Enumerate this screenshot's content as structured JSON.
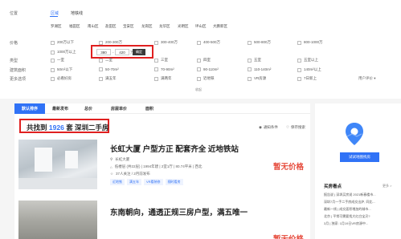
{
  "filters": {
    "position": {
      "label": "位置",
      "tabs": [
        "区域",
        "地铁线"
      ],
      "subitems": [
        "罗湖区",
        "福田区",
        "南山区",
        "盐田区",
        "宝安区",
        "龙岗区",
        "龙华区",
        "光明区",
        "坪山区",
        "大鹏新区"
      ]
    },
    "price": {
      "label": "价格",
      "options": [
        "200万以下",
        "200-300万",
        "300-400万",
        "400-500万",
        "500-800万",
        "800-1000万",
        "1000万以上"
      ],
      "min_value": "380",
      "max_value": "420",
      "unit": "万",
      "dash": "-",
      "confirm_label": "确定"
    },
    "type": {
      "label": "类型",
      "options": [
        "一室",
        "二室",
        "三室",
        "四室",
        "五室",
        "五室以上"
      ]
    },
    "area": {
      "label": "建筑面积",
      "options": [
        "50m²以下",
        "50-70m²",
        "70-90m²",
        "90-110m²",
        "110-140m²",
        "140m²以上"
      ]
    },
    "more": {
      "label": "更多选项",
      "options": [
        "必看好房",
        "满五年",
        "满两年",
        "近地铁",
        "VR房源",
        "7日新上"
      ],
      "more_link": "用户评价 ▾"
    },
    "collapse_label": "收起"
  },
  "sort_tabs": [
    "默认排序",
    "最新发布",
    "总价",
    "房屋单价",
    "面积"
  ],
  "result": {
    "prefix": "共找到",
    "count": "1926",
    "suffix": "套 深圳二手房",
    "save_search_label": "保存搜索",
    "subscribe_label": "通知条件"
  },
  "listings": [
    {
      "title": "长虹大厦 户型方正 配套齐全 近地铁站",
      "community": "长虹大厦",
      "info": "低楼层 (共22层) | 1994年建 | 2室1厅 | 80.74平米 | 西北",
      "followers": "37人关注 / 2月前发布",
      "tags": [
        "近地铁",
        "满五年",
        "VR看装修",
        "随时看房"
      ],
      "price": "暂无价格"
    },
    {
      "title": "东南朝向，通透正规三房户型，满五唯一",
      "price": "暂无价格"
    }
  ],
  "sidebar": {
    "map_button_label": "试试地图找房",
    "news_title": "买房看点",
    "news_more": "更多 >",
    "news_items": [
      "报告说 | 深圳买房说 2021新春楼市...",
      "深圳7月一手二手房成交出炉, 同比...",
      "最新一线 | 成交面积增加的城市...",
      "北京 | 平常可需要找大红白宝贝?",
      "3月 | 独家: 1月19日VR房源中..."
    ]
  },
  "colors": {
    "accent": "#3072f6",
    "highlight_box": "#e02020",
    "price": "#e64b3c"
  }
}
